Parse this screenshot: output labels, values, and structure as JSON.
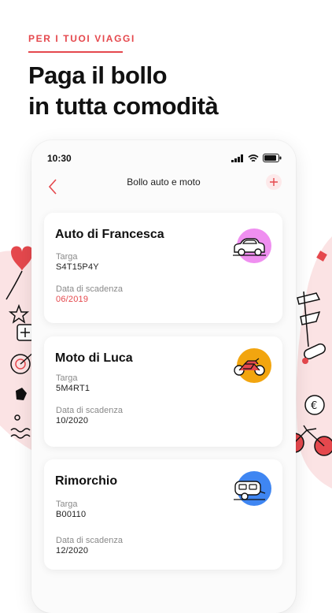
{
  "promo": {
    "eyebrow": "PER I TUOI VIAGGI",
    "headline_line1": "Paga il bollo",
    "headline_line2": "in tutta comodità"
  },
  "status_bar": {
    "time": "10:30"
  },
  "nav": {
    "title": "Bollo auto e moto",
    "back_icon": "chevron-left-icon",
    "add_icon": "plus-icon"
  },
  "vehicles": [
    {
      "name": "Auto di Francesca",
      "plate_label": "Targa",
      "plate": "S4T15P4Y",
      "expiry_label": "Data di scadenza",
      "expiry": "06/2019",
      "expired": true,
      "icon": "car-icon",
      "badge_color": "#ef8ff0"
    },
    {
      "name": "Moto di Luca",
      "plate_label": "Targa",
      "plate": "5M4RT1",
      "expiry_label": "Data di scadenza",
      "expiry": "10/2020",
      "expired": false,
      "icon": "motorcycle-icon",
      "badge_color": "#f2a50f"
    },
    {
      "name": "Rimorchio",
      "plate_label": "Targa",
      "plate": "B00110",
      "expiry_label": "Data di scadenza",
      "expiry": "12/2020",
      "expired": false,
      "icon": "trailer-icon",
      "badge_color": "#3f86f2"
    }
  ],
  "colors": {
    "accent": "#e5484d",
    "decor_pink": "#fbe3e4"
  }
}
